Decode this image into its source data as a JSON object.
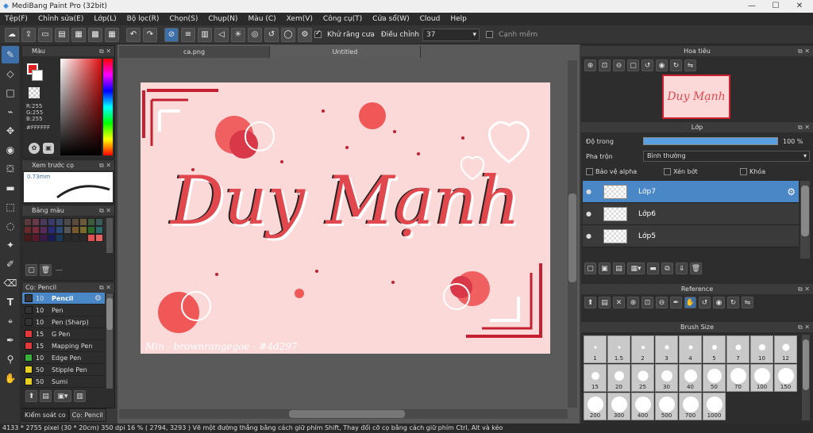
{
  "window": {
    "title": "MediBang Paint Pro (32bit)"
  },
  "menu": [
    "Tệp(F)",
    "Chỉnh sửa(E)",
    "Lớp(L)",
    "Bộ lọc(R)",
    "Chọn(S)",
    "Chụp(N)",
    "Màu (C)",
    "Xem(V)",
    "Công cụ(T)",
    "Cửa sổ(W)",
    "Cloud",
    "Help"
  ],
  "toolbar": {
    "antialias_label": "Khử răng cưa",
    "adjust_label": "Điều chỉnh",
    "adjust_value": "37",
    "snap_label": "Cạnh mềm"
  },
  "panels": {
    "color": {
      "title": "Màu",
      "r": "R:255",
      "g": "G:255",
      "b": "B:255",
      "hex": "#FFFFFF"
    },
    "preview": {
      "title": "Xem trước cọ",
      "size": "0.73mm"
    },
    "swatches": {
      "title": "Bảng màu",
      "dash": "---"
    },
    "brush": {
      "title": "Cọ: Pencil"
    },
    "navigator": {
      "title": "Hoa tiêu"
    },
    "layer": {
      "title": "Lớp",
      "opacity_label": "Độ trong",
      "opacity_value": "100 %",
      "blend_label": "Pha trộn",
      "blend_value": "Bình thường",
      "protect_alpha": "Bảo vệ alpha",
      "clip": "Xén bớt",
      "lock": "Khóa"
    },
    "reference": {
      "title": "Reference"
    },
    "brushsize": {
      "title": "Brush Size"
    }
  },
  "bottom_tabs": [
    "Kiểm soát co",
    "Cọ: Pencil"
  ],
  "canvas_tabs": [
    "ca.png",
    "Untitled"
  ],
  "layers": [
    {
      "name": "Lớp7"
    },
    {
      "name": "Lớp6"
    },
    {
      "name": "Lớp5"
    }
  ],
  "brushes": [
    {
      "size": "10",
      "name": "Pencil",
      "color": "#333333"
    },
    {
      "size": "10",
      "name": "Pen",
      "color": "#333333"
    },
    {
      "size": "10",
      "name": "Pen (Sharp)",
      "color": "#333333"
    },
    {
      "size": "15",
      "name": "G Pen",
      "color": "#e03a3a"
    },
    {
      "size": "15",
      "name": "Mapping Pen",
      "color": "#e03a3a"
    },
    {
      "size": "10",
      "name": "Edge Pen",
      "color": "#3ab03a"
    },
    {
      "size": "50",
      "name": "Stipple Pen",
      "color": "#e8d020"
    },
    {
      "size": "50",
      "name": "Sumi",
      "color": "#e8d020"
    }
  ],
  "brush_sizes": [
    "1",
    "1.5",
    "2",
    "3",
    "4",
    "5",
    "7",
    "10",
    "12",
    "15",
    "20",
    "25",
    "30",
    "40",
    "50",
    "70",
    "100",
    "150",
    "200",
    "300",
    "400",
    "500",
    "700",
    "1000"
  ],
  "swatch_colors": [
    "#5a3a3a",
    "#6a3a4a",
    "#4a3a5a",
    "#3a3a6a",
    "#3a4a6a",
    "#4a4a4a",
    "#5a4a3a",
    "#6a5a3a",
    "#3a5a3a",
    "#3a5a5a",
    "#6a2a2a",
    "#7a2a3a",
    "#5a2a5a",
    "#2a2a7a",
    "#2a4a7a",
    "#555555",
    "#7a5a2a",
    "#7a6a2a",
    "#2a6a2a",
    "#2a6a6a",
    "#4a1a1a",
    "#5a1a2a",
    "#3a1a4a",
    "#1a1a5a",
    "#1a3a5a",
    "#2a2a2a",
    "#2a2a2a",
    "#2a2a2a",
    "#e05050",
    "#e86060"
  ],
  "artwork": {
    "text": "Duy Mạnh",
    "credit": "Min - brownrangegoe - #4d297"
  },
  "status": "4133 * 2755 pixel   (30 * 20cm)   350 dpi   16 %   ( 2794, 3293 )   Vẽ một đường thẳng bằng cách giữ phím Shift, Thay đổi cỡ cọ bằng cách giữ phím Ctrl, Alt và kéo"
}
